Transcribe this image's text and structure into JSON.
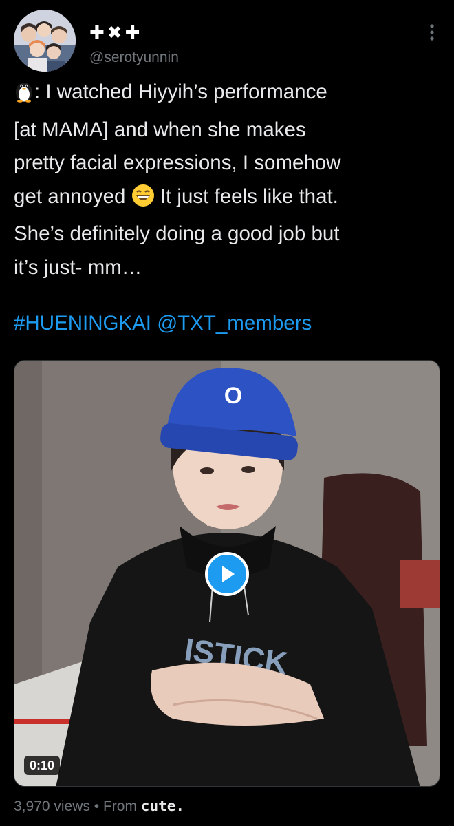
{
  "author": {
    "display_name": "✚✖✚",
    "handle": "@serotyunnin"
  },
  "tweet": {
    "lines": [
      ": I watched Hiyyih’s performance",
      "[at MAMA] and when she makes",
      "pretty facial expressions, I somehow",
      "get annoyed",
      "It just feels like that.",
      "She’s definitely doing a good job but",
      "it’s just- mm…"
    ],
    "leading_icon": "penguin-icon",
    "inline_emoji": "grinning-face-emoji",
    "hashtag": "#HUENINGKAI",
    "mention": "@TXT_members"
  },
  "media": {
    "type": "video",
    "duration": "0:10",
    "play_icon": "play-icon",
    "hoodie_text": "ISTICK",
    "beanie_logo": "O"
  },
  "footer": {
    "views": "3,970 views",
    "separator": "•",
    "from_label": "From",
    "source": "cute."
  },
  "colors": {
    "background": "#000000",
    "text": "#e7e9ea",
    "secondary_text": "#71767b",
    "link": "#1d9bf0",
    "play_button": "#1d9bf0"
  }
}
